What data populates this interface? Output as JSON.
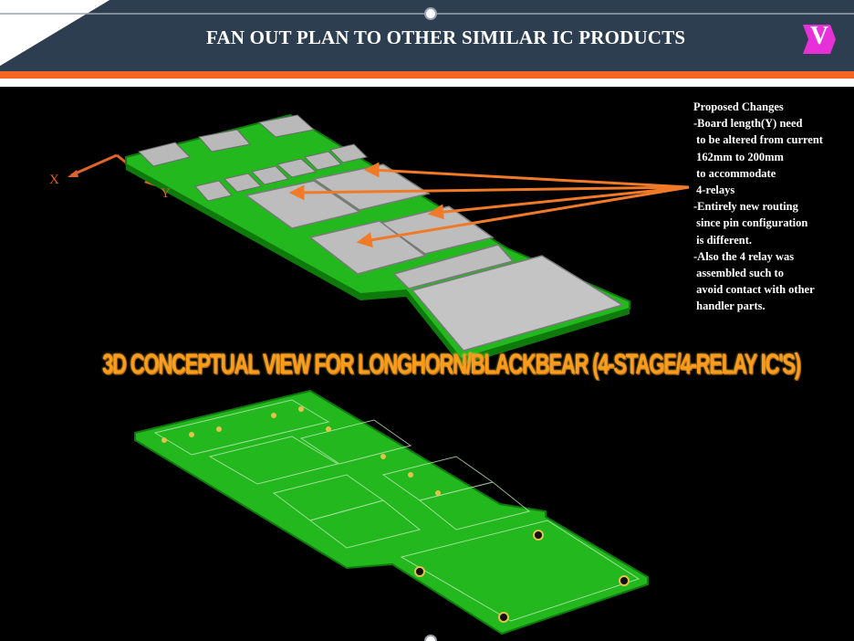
{
  "header": {
    "title": "FAN OUT PLAN TO OTHER SIMILAR IC PRODUCTS",
    "badge_letter": "V",
    "colors": {
      "navy": "#2d3e50",
      "orange": "#f26522",
      "badge": "#e830d8"
    }
  },
  "axes": {
    "x_label": "X",
    "y_label": "Y"
  },
  "notes": {
    "lines": [
      "Proposed Changes",
      "-Board length(Y) need",
      " to be altered from current",
      " 162mm to 200mm",
      " to accommodate",
      " 4-relays",
      "-Entirely new routing",
      " since pin configuration",
      " is different.",
      "-Also the 4 relay was",
      " assembled such to",
      " avoid contact with other",
      " handler parts."
    ]
  },
  "banner": {
    "text": "3D CONCEPTUAL VIEW FOR LONGHORN/BLACKBEAR (4-STAGE/4-RELAY IC'S)"
  },
  "colors": {
    "pcb": "#22b81e",
    "pcb_edge": "#0f7a0c",
    "relay": "#b9b9b9",
    "arrow": "#f07a28"
  }
}
